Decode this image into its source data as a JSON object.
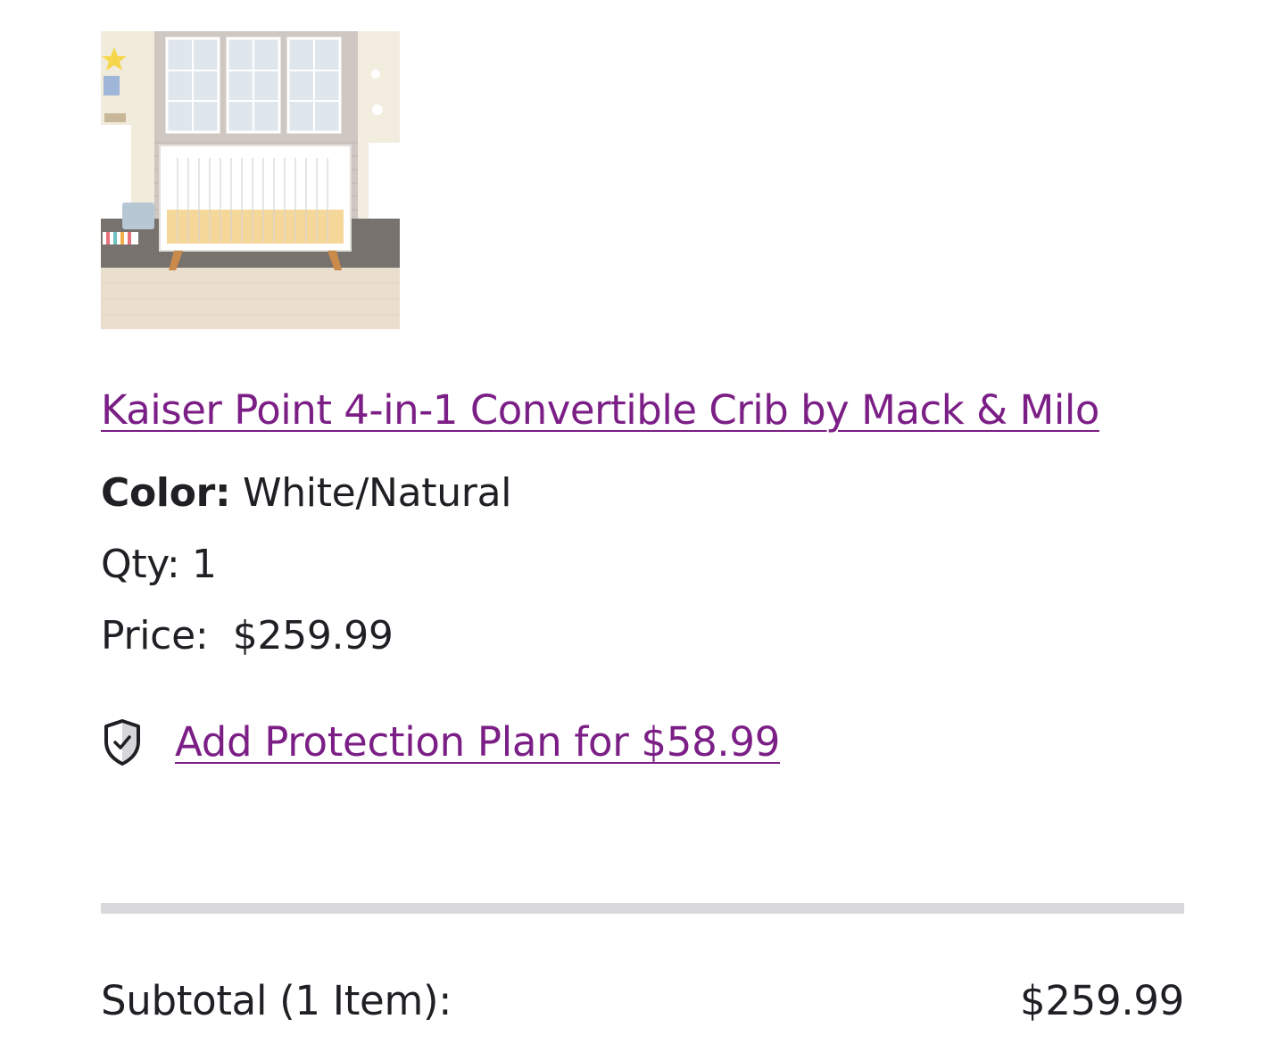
{
  "product": {
    "image_alt": "Crib in nursery",
    "title": "Kaiser Point 4-in-1 Convertible Crib by Mack & Milo",
    "color_label": "Color:",
    "color_value": "White/Natural",
    "qty_label": "Qty:",
    "qty_value": "1",
    "price_label": "Price:",
    "price_value": "$259.99"
  },
  "protection": {
    "icon": "shield-check-icon",
    "link_text": "Add Protection Plan for $58.99"
  },
  "summary": {
    "subtotal_label": "Subtotal (1 Item):",
    "subtotal_value": "$259.99"
  },
  "colors": {
    "link": "#7b1f86",
    "text": "#1f1f24",
    "divider": "#d9d9dc"
  }
}
